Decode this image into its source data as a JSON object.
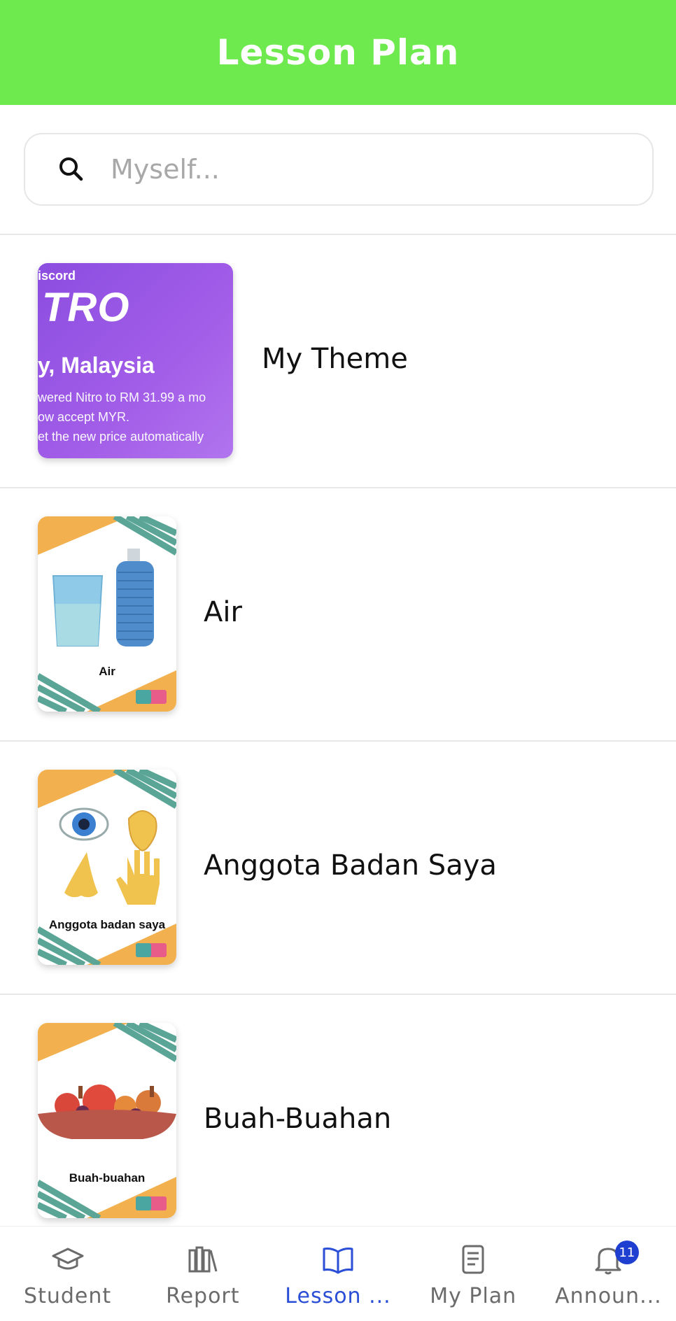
{
  "header": {
    "title": "Lesson Plan"
  },
  "search": {
    "placeholder": "Myself..."
  },
  "lessons": [
    {
      "title": "My Theme",
      "thumb": {
        "brand": "iscord",
        "headline": "TRO",
        "location": "y, Malaysia",
        "lines": [
          "wered Nitro to RM 31.99 a mo",
          "ow accept MYR.",
          "et the new price automatically"
        ]
      }
    },
    {
      "title": "Air",
      "caption": "Air",
      "logo": "Anak2u"
    },
    {
      "title": "Anggota Badan Saya",
      "caption": "Anggota badan saya",
      "logo": "Anak2u"
    },
    {
      "title": "Buah-Buahan",
      "caption": "Buah-buahan",
      "logo": "Anak2u"
    }
  ],
  "nav": {
    "items": [
      {
        "label": "Student",
        "icon": "graduation-cap-icon"
      },
      {
        "label": "Report",
        "icon": "library-icon"
      },
      {
        "label": "Lesson ...",
        "icon": "open-book-icon",
        "active": true
      },
      {
        "label": "My Plan",
        "icon": "document-icon"
      },
      {
        "label": "Announ...",
        "icon": "bell-icon",
        "badge": "11"
      }
    ]
  },
  "colors": {
    "header": "#6ee94e",
    "active": "#2a4fd6",
    "badge": "#1f3fd0"
  }
}
